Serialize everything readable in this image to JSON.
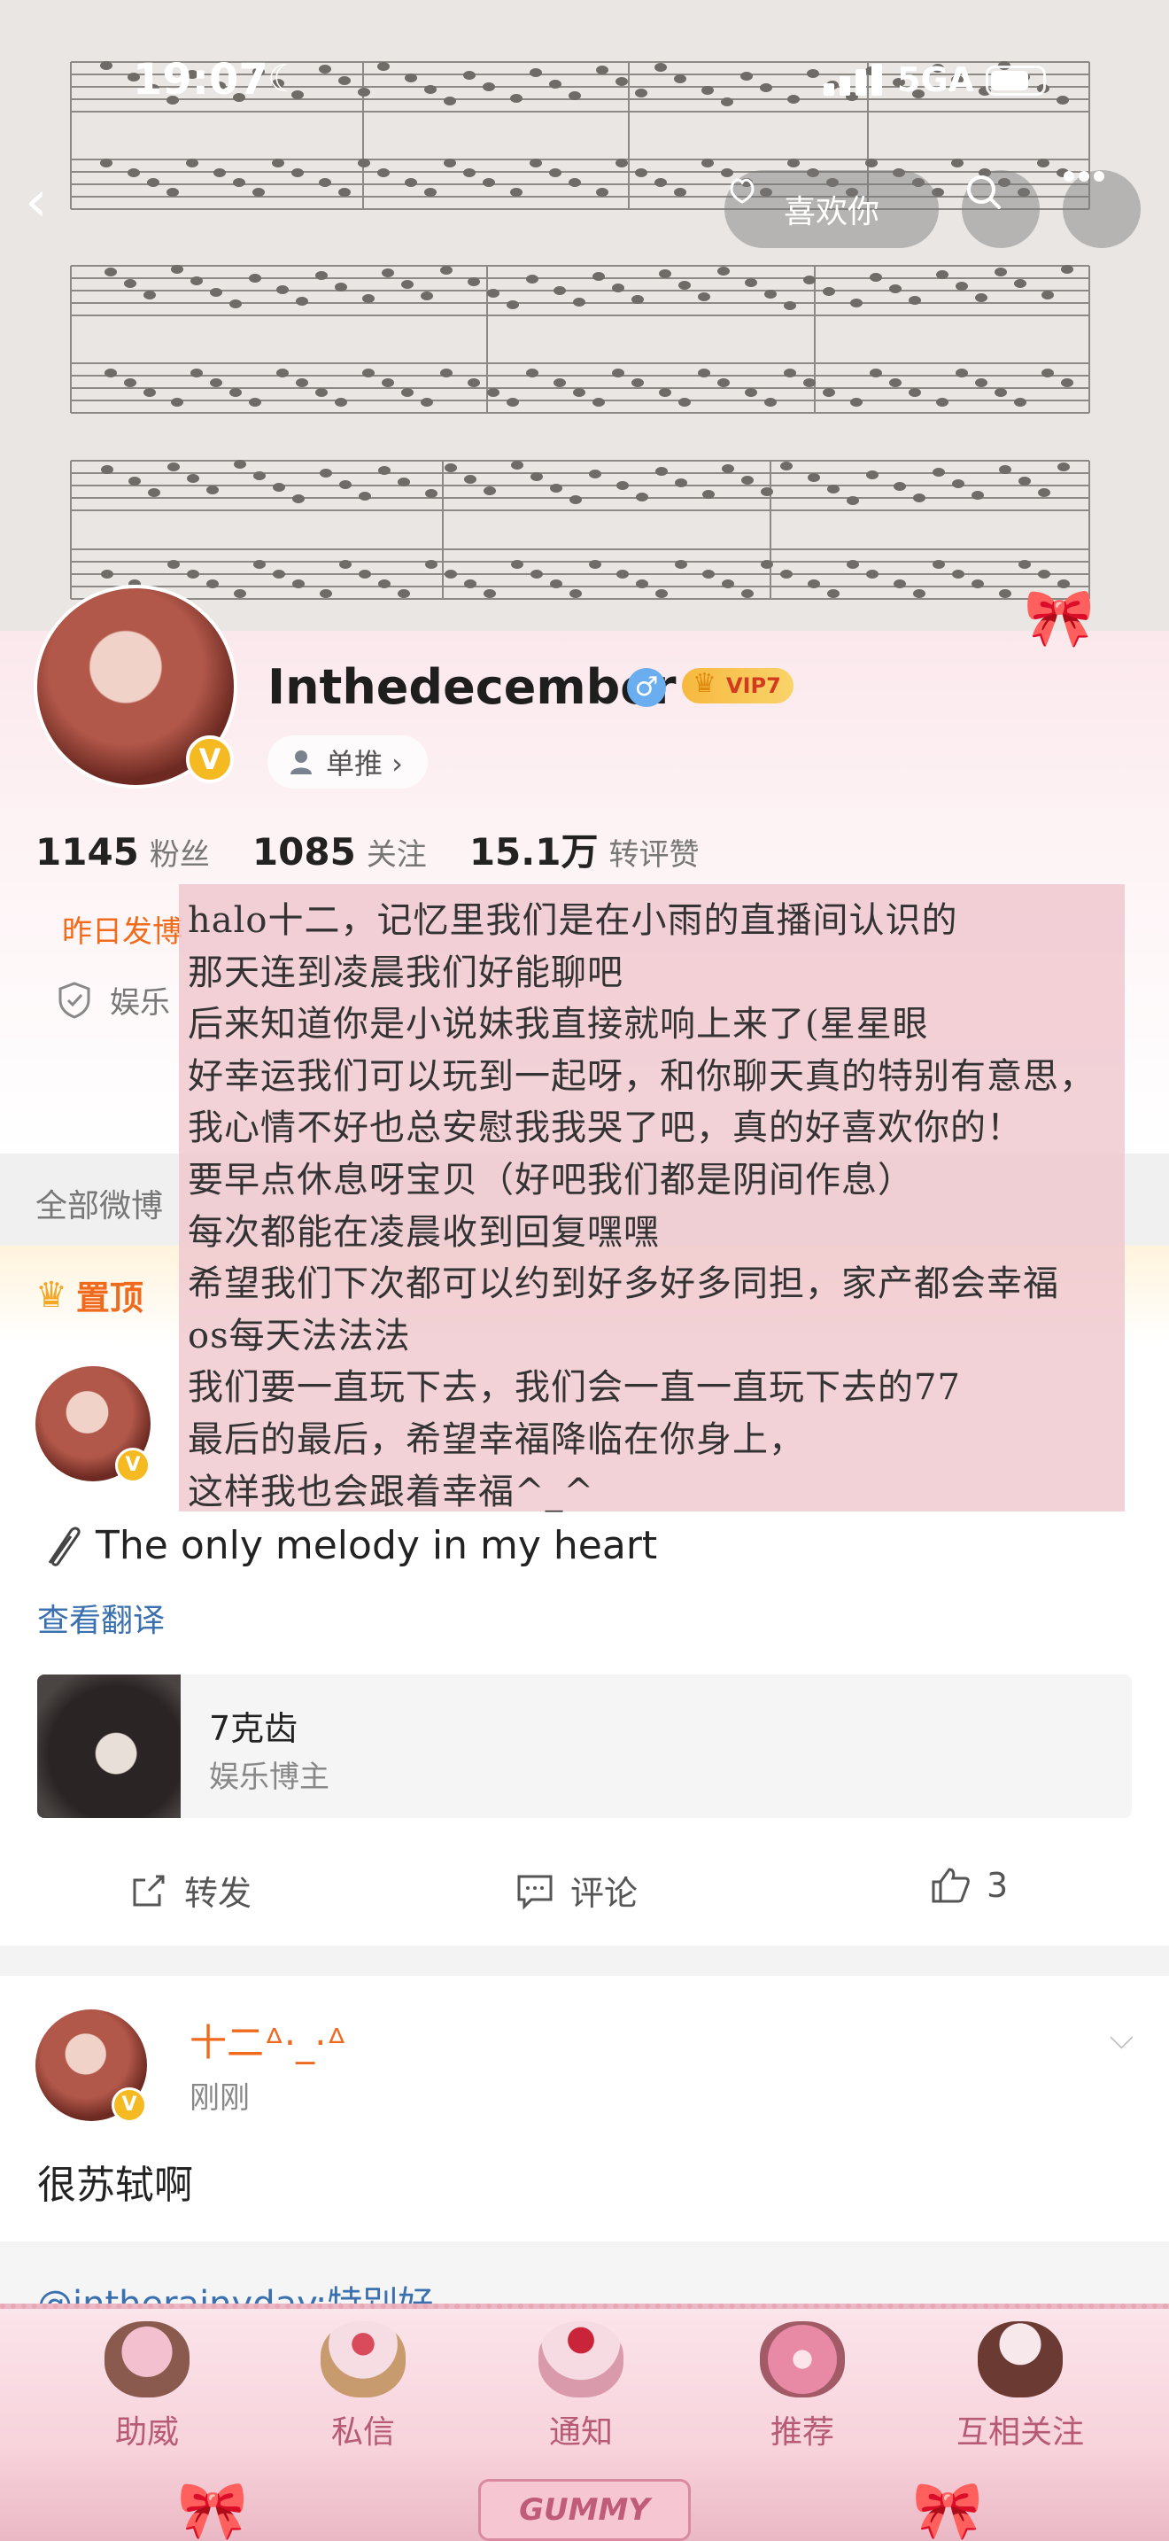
{
  "status_bar": {
    "time": "19:07",
    "network": "5GA"
  },
  "header": {
    "like_button": "喜欢你"
  },
  "profile": {
    "username": "Inthedecember",
    "vip_badge": "VIP7",
    "single_push": "单推 ›",
    "stats": [
      {
        "value": "1145",
        "label": "粉丝"
      },
      {
        "value": "1085",
        "label": "关注"
      },
      {
        "value": "15.1万",
        "label": "转评赞"
      }
    ],
    "yesterday_label": "昨日发博",
    "verify_label": "娱乐"
  },
  "note": {
    "lines": [
      "halo十二，记忆里我们是在小雨的直播间认识的",
      "那天连到凌晨我们好能聊吧",
      "后来知道你是小说妹我直接就响上来了(星星眼",
      "好幸运我们可以玩到一起呀，和你聊天真的特别有意思，",
      "我心情不好也总安慰我我哭了吧，真的好喜欢你的！",
      "要早点休息呀宝贝（好吧我们都是阴间作息）",
      "每次都能在凌晨收到回复嘿嘿",
      "希望我们下次都可以约到好多好多同担，家产都会幸福",
      "os每天法法法",
      "我们要一直玩下去，我们会一直一直玩下去的77",
      "最后的最后，希望幸福降临在你身上，",
      "这样我也会跟着幸福^_^"
    ]
  },
  "tabs": {
    "all_posts": "全部微博"
  },
  "pinned": {
    "label": "置顶"
  },
  "post1": {
    "text": "The only melody in my heart",
    "translate": "查看翻译",
    "card": {
      "title": "7克齿",
      "subtitle": "娱乐博主"
    },
    "actions": {
      "repost": "转发",
      "comment": "评论",
      "like_count": "3"
    }
  },
  "post2": {
    "name": "十二ᐞ·_·ᐞ",
    "time": "刚刚",
    "text": "很苏轼啊",
    "quote": "@intherainyday:特别好"
  },
  "bottom_nav": {
    "items": [
      {
        "label": "助威",
        "icon": "cake-icon"
      },
      {
        "label": "私信",
        "icon": "ice-cream-icon"
      },
      {
        "label": "通知",
        "icon": "cherry-cake-icon"
      },
      {
        "label": "推荐",
        "icon": "donut-icon"
      },
      {
        "label": "互相关注",
        "icon": "chocolate-cake-icon"
      }
    ],
    "center_badge": "GUMMY"
  },
  "colors": {
    "accent_orange": "#f06a1e",
    "link_blue": "#3a6fb0",
    "note_pink": "#eec4cc",
    "vip_gold": "#f7b93f"
  }
}
